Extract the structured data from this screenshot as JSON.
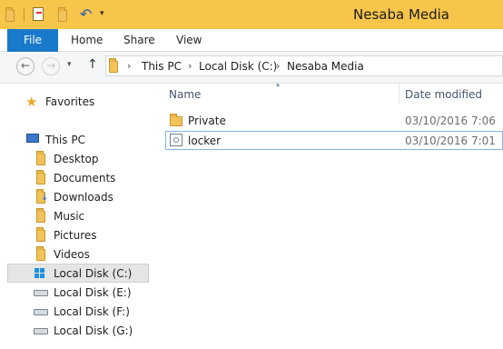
{
  "window": {
    "title": "Nesaba Media"
  },
  "ribbon": {
    "tabs": [
      "File",
      "Home",
      "Share",
      "View"
    ]
  },
  "address": {
    "breadcrumbs": [
      "This PC",
      "Local Disk (C:)",
      "Nesaba Media"
    ]
  },
  "nav": {
    "favorites": "Favorites",
    "this_pc": "This PC",
    "items": [
      "Desktop",
      "Documents",
      "Downloads",
      "Music",
      "Pictures",
      "Videos"
    ],
    "drives": [
      "Local Disk (C:)",
      "Local Disk (E:)",
      "Local Disk (F:)",
      "Local Disk (G:)"
    ]
  },
  "columns": {
    "name": "Name",
    "date_modified": "Date modified"
  },
  "files": [
    {
      "name": "Private",
      "date": "03/10/2016 7:06",
      "icon": "folder-icon"
    },
    {
      "name": "locker",
      "date": "03/10/2016 7:01",
      "icon": "batch-file-icon"
    }
  ],
  "colors": {
    "accent": "#1979ca",
    "titlebar": "#f6c54a",
    "selection": "#cce8ff"
  }
}
